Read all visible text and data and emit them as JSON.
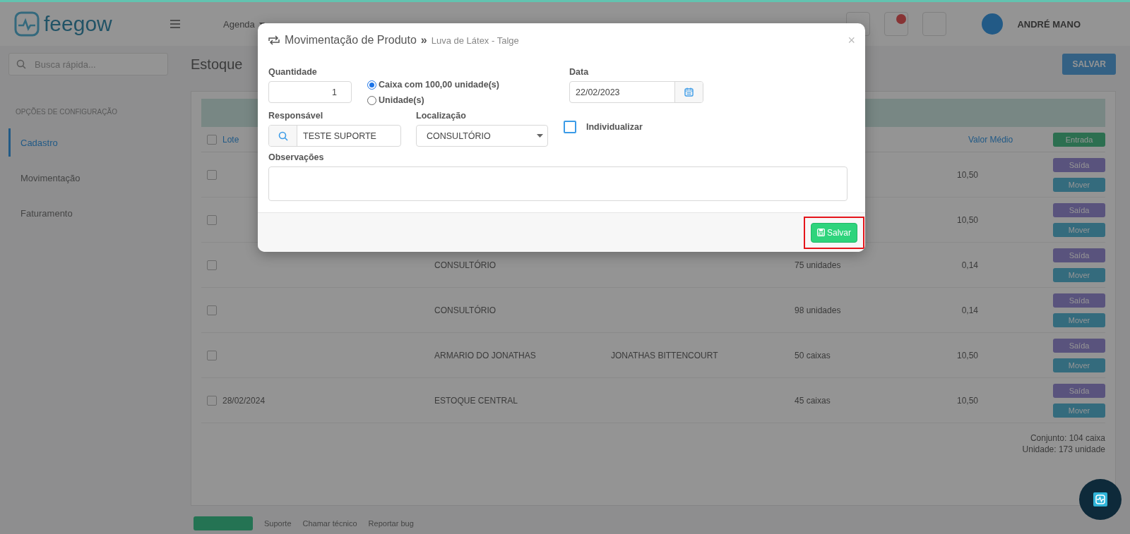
{
  "app": {
    "logo": "feegow",
    "search_placeholder": "Busca rápida...",
    "nav": [
      {
        "label": "Agenda"
      }
    ],
    "user": {
      "name": "ANDRÉ MANO"
    }
  },
  "sidebar": {
    "section": "OPÇÕES DE CONFIGURAÇÃO",
    "items": [
      {
        "label": "Cadastro",
        "selected": true
      },
      {
        "label": "Movimentação",
        "selected": false
      },
      {
        "label": "Faturamento",
        "selected": false
      }
    ]
  },
  "page": {
    "title": "Estoque",
    "toolbar_button": "SALVAR"
  },
  "table": {
    "select_all_checked": false,
    "columns": [
      {
        "label": "Lote"
      },
      {
        "label": "Valor Médio"
      }
    ],
    "entry_button": "Entrada",
    "rows": [
      {
        "checked": false,
        "lote": "",
        "local": "",
        "responsavel": "",
        "quantidade": "",
        "valor": "10,50",
        "buttons": [
          "Saída",
          "Mover"
        ]
      },
      {
        "checked": false,
        "lote": "",
        "local": "",
        "responsavel": "",
        "quantidade": "",
        "valor": "10,50",
        "buttons": [
          "Saída",
          "Mover"
        ]
      },
      {
        "checked": false,
        "lote": "",
        "local": "CONSULTÓRIO",
        "responsavel": "",
        "quantidade": "75 unidades",
        "valor": "0,14",
        "buttons": [
          "Saída",
          "Mover"
        ]
      },
      {
        "checked": false,
        "lote": "",
        "local": "CONSULTÓRIO",
        "responsavel": "",
        "quantidade": "98 unidades",
        "valor": "0,14",
        "buttons": [
          "Saída",
          "Mover"
        ]
      },
      {
        "checked": false,
        "lote": "",
        "local": "ARMARIO DO JONATHAS",
        "responsavel": "JONATHAS BITTENCOURT",
        "quantidade": "50 caixas",
        "valor": "10,50",
        "buttons": [
          "Saída",
          "Mover"
        ]
      },
      {
        "checked": false,
        "lote": "28/02/2024",
        "local": "ESTOQUE CENTRAL",
        "responsavel": "",
        "quantidade": "45 caixas",
        "valor": "10,50",
        "buttons": [
          "Saída",
          "Mover"
        ]
      }
    ],
    "totals": [
      "Conjunto: 104 caixa",
      "Unidade: 173 unidade"
    ]
  },
  "footer": {
    "links": [
      "Suporte",
      "Chamar técnico",
      "Reportar bug"
    ]
  },
  "modal": {
    "title": "Movimentação de Produto",
    "separator": "»",
    "subtitle": "Luva de Látex - Talge",
    "close": "×",
    "quantity": {
      "label": "Quantidade",
      "value": "1"
    },
    "units": [
      {
        "label": "Caixa com 100,00 unidade(s)",
        "selected": true
      },
      {
        "label": "Unidade(s)",
        "selected": false
      }
    ],
    "date": {
      "label": "Data",
      "value": "22/02/2023"
    },
    "responsible": {
      "label": "Responsável",
      "value": "TESTE SUPORTE"
    },
    "location": {
      "label": "Localização",
      "value": "CONSULTÓRIO"
    },
    "individualize": {
      "label": "Individualizar",
      "checked": false
    },
    "notes": {
      "label": "Observações"
    },
    "save": {
      "label": "Salvar",
      "highlighted": true
    }
  }
}
